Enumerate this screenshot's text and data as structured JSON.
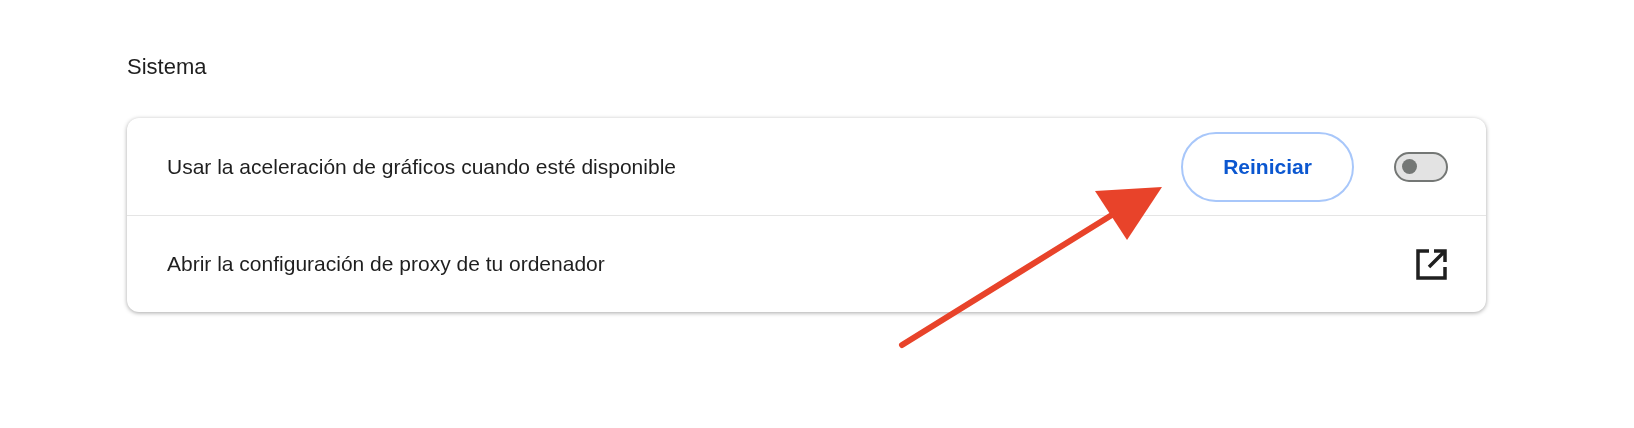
{
  "section_title": "Sistema",
  "rows": [
    {
      "kind": "toggle",
      "label": "Usar la aceleración de gráficos cuando esté disponible",
      "button": "Reiniciar",
      "on": false
    },
    {
      "kind": "link",
      "label": "Abrir la configuración de proxy de tu ordenador"
    }
  ]
}
